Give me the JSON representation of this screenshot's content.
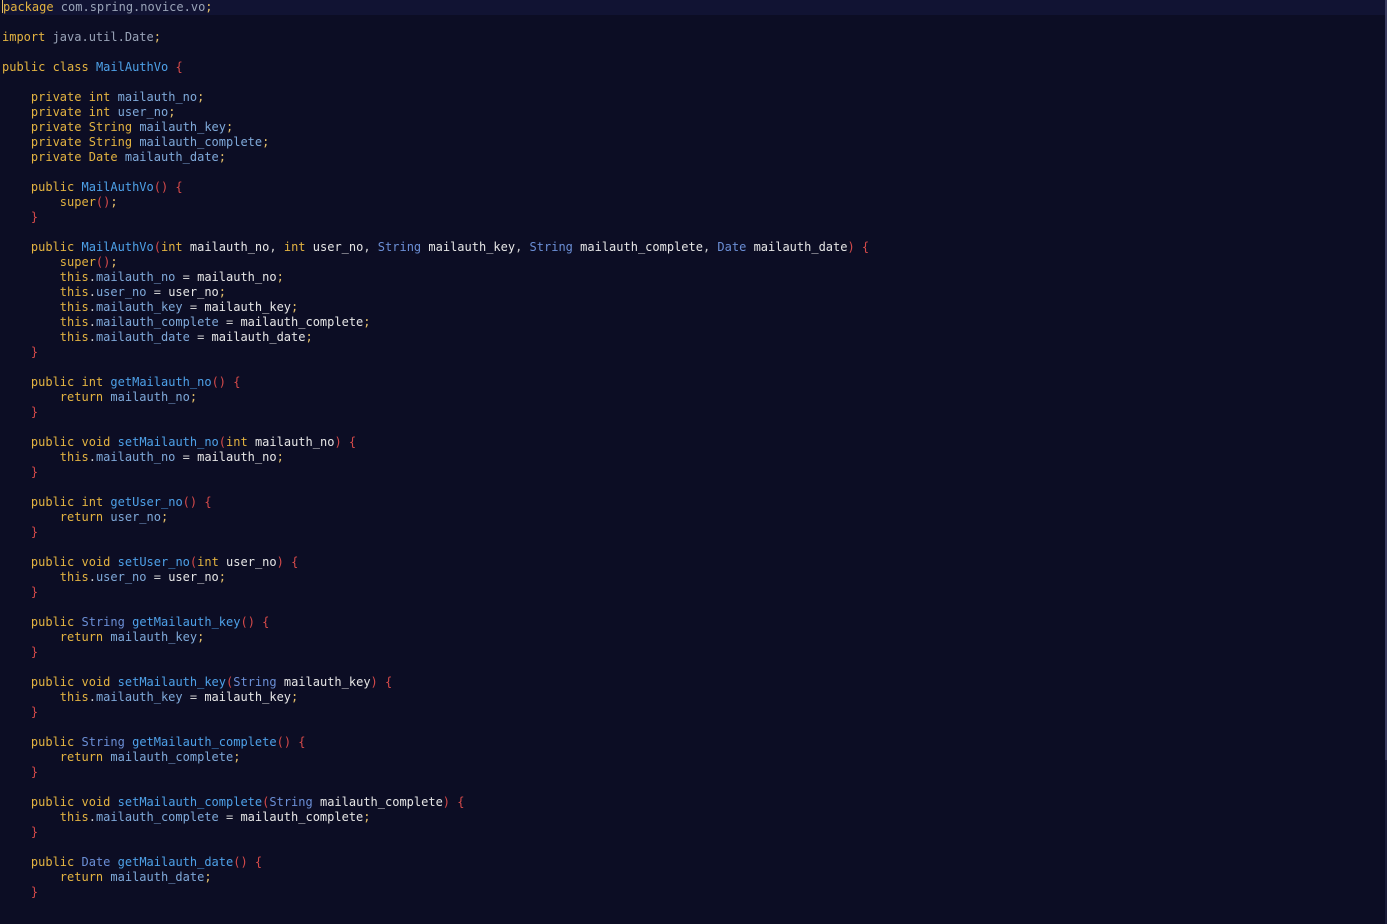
{
  "editor": {
    "language": "java",
    "lines": [
      [
        [
          "kw",
          "package"
        ],
        [
          "pkg",
          " com.spring.novice.vo"
        ],
        [
          "semi",
          ";"
        ]
      ],
      [],
      [
        [
          "kw",
          "import"
        ],
        [
          "pkg",
          " java.util.Date"
        ],
        [
          "semi",
          ";"
        ]
      ],
      [],
      [
        [
          "kw",
          "public"
        ],
        [
          "op",
          " "
        ],
        [
          "kw",
          "class"
        ],
        [
          "op",
          " "
        ],
        [
          "fn",
          "MailAuthVo"
        ],
        [
          "op",
          " "
        ],
        [
          "punc",
          "{"
        ]
      ],
      [],
      [
        [
          "op",
          "    "
        ],
        [
          "kw",
          "private"
        ],
        [
          "op",
          " "
        ],
        [
          "kw",
          "int"
        ],
        [
          "op",
          " "
        ],
        [
          "field",
          "mailauth_no"
        ],
        [
          "semi",
          ";"
        ]
      ],
      [
        [
          "op",
          "    "
        ],
        [
          "kw",
          "private"
        ],
        [
          "op",
          " "
        ],
        [
          "kw",
          "int"
        ],
        [
          "op",
          " "
        ],
        [
          "field",
          "user_no"
        ],
        [
          "semi",
          ";"
        ]
      ],
      [
        [
          "op",
          "    "
        ],
        [
          "kw",
          "private"
        ],
        [
          "op",
          " "
        ],
        [
          "kw",
          "String"
        ],
        [
          "op",
          " "
        ],
        [
          "field",
          "mailauth_key"
        ],
        [
          "semi",
          ";"
        ]
      ],
      [
        [
          "op",
          "    "
        ],
        [
          "kw",
          "private"
        ],
        [
          "op",
          " "
        ],
        [
          "kw",
          "String"
        ],
        [
          "op",
          " "
        ],
        [
          "field",
          "mailauth_complete"
        ],
        [
          "semi",
          ";"
        ]
      ],
      [
        [
          "op",
          "    "
        ],
        [
          "kw",
          "private"
        ],
        [
          "op",
          " "
        ],
        [
          "kw",
          "Date"
        ],
        [
          "op",
          " "
        ],
        [
          "field",
          "mailauth_date"
        ],
        [
          "semi",
          ";"
        ]
      ],
      [],
      [
        [
          "op",
          "    "
        ],
        [
          "kw",
          "public"
        ],
        [
          "op",
          " "
        ],
        [
          "fn",
          "MailAuthVo"
        ],
        [
          "punc",
          "() {"
        ]
      ],
      [
        [
          "op",
          "        "
        ],
        [
          "kw",
          "super"
        ],
        [
          "punc",
          "()"
        ],
        [
          "semi",
          ";"
        ]
      ],
      [
        [
          "op",
          "    "
        ],
        [
          "punc",
          "}"
        ]
      ],
      [],
      [
        [
          "op",
          "    "
        ],
        [
          "kw",
          "public"
        ],
        [
          "op",
          " "
        ],
        [
          "fn",
          "MailAuthVo"
        ],
        [
          "punc",
          "("
        ],
        [
          "kw",
          "int"
        ],
        [
          "op",
          " "
        ],
        [
          "var",
          "mailauth_no"
        ],
        [
          "op",
          ", "
        ],
        [
          "kw",
          "int"
        ],
        [
          "op",
          " "
        ],
        [
          "var",
          "user_no"
        ],
        [
          "op",
          ", "
        ],
        [
          "type",
          "String"
        ],
        [
          "op",
          " "
        ],
        [
          "var",
          "mailauth_key"
        ],
        [
          "op",
          ", "
        ],
        [
          "type",
          "String"
        ],
        [
          "op",
          " "
        ],
        [
          "var",
          "mailauth_complete"
        ],
        [
          "op",
          ", "
        ],
        [
          "type",
          "Date"
        ],
        [
          "op",
          " "
        ],
        [
          "var",
          "mailauth_date"
        ],
        [
          "punc",
          ") {"
        ]
      ],
      [
        [
          "op",
          "        "
        ],
        [
          "kw",
          "super"
        ],
        [
          "punc",
          "()"
        ],
        [
          "semi",
          ";"
        ]
      ],
      [
        [
          "op",
          "        "
        ],
        [
          "kw",
          "this"
        ],
        [
          "op",
          "."
        ],
        [
          "field",
          "mailauth_no"
        ],
        [
          "op",
          " = "
        ],
        [
          "var",
          "mailauth_no"
        ],
        [
          "semi",
          ";"
        ]
      ],
      [
        [
          "op",
          "        "
        ],
        [
          "kw",
          "this"
        ],
        [
          "op",
          "."
        ],
        [
          "field",
          "user_no"
        ],
        [
          "op",
          " = "
        ],
        [
          "var",
          "user_no"
        ],
        [
          "semi",
          ";"
        ]
      ],
      [
        [
          "op",
          "        "
        ],
        [
          "kw",
          "this"
        ],
        [
          "op",
          "."
        ],
        [
          "field",
          "mailauth_key"
        ],
        [
          "op",
          " = "
        ],
        [
          "var",
          "mailauth_key"
        ],
        [
          "semi",
          ";"
        ]
      ],
      [
        [
          "op",
          "        "
        ],
        [
          "kw",
          "this"
        ],
        [
          "op",
          "."
        ],
        [
          "field",
          "mailauth_complete"
        ],
        [
          "op",
          " = "
        ],
        [
          "var",
          "mailauth_complete"
        ],
        [
          "semi",
          ";"
        ]
      ],
      [
        [
          "op",
          "        "
        ],
        [
          "kw",
          "this"
        ],
        [
          "op",
          "."
        ],
        [
          "field",
          "mailauth_date"
        ],
        [
          "op",
          " = "
        ],
        [
          "var",
          "mailauth_date"
        ],
        [
          "semi",
          ";"
        ]
      ],
      [
        [
          "op",
          "    "
        ],
        [
          "punc",
          "}"
        ]
      ],
      [],
      [
        [
          "op",
          "    "
        ],
        [
          "kw",
          "public"
        ],
        [
          "op",
          " "
        ],
        [
          "kw",
          "int"
        ],
        [
          "op",
          " "
        ],
        [
          "fn",
          "getMailauth_no"
        ],
        [
          "punc",
          "() {"
        ]
      ],
      [
        [
          "op",
          "        "
        ],
        [
          "kw",
          "return"
        ],
        [
          "op",
          " "
        ],
        [
          "field",
          "mailauth_no"
        ],
        [
          "semi",
          ";"
        ]
      ],
      [
        [
          "op",
          "    "
        ],
        [
          "punc",
          "}"
        ]
      ],
      [],
      [
        [
          "op",
          "    "
        ],
        [
          "kw",
          "public"
        ],
        [
          "op",
          " "
        ],
        [
          "kw",
          "void"
        ],
        [
          "op",
          " "
        ],
        [
          "fn",
          "setMailauth_no"
        ],
        [
          "punc",
          "("
        ],
        [
          "kw",
          "int"
        ],
        [
          "op",
          " "
        ],
        [
          "var",
          "mailauth_no"
        ],
        [
          "punc",
          ") {"
        ]
      ],
      [
        [
          "op",
          "        "
        ],
        [
          "kw",
          "this"
        ],
        [
          "op",
          "."
        ],
        [
          "field",
          "mailauth_no"
        ],
        [
          "op",
          " = "
        ],
        [
          "var",
          "mailauth_no"
        ],
        [
          "semi",
          ";"
        ]
      ],
      [
        [
          "op",
          "    "
        ],
        [
          "punc",
          "}"
        ]
      ],
      [],
      [
        [
          "op",
          "    "
        ],
        [
          "kw",
          "public"
        ],
        [
          "op",
          " "
        ],
        [
          "kw",
          "int"
        ],
        [
          "op",
          " "
        ],
        [
          "fn",
          "getUser_no"
        ],
        [
          "punc",
          "() {"
        ]
      ],
      [
        [
          "op",
          "        "
        ],
        [
          "kw",
          "return"
        ],
        [
          "op",
          " "
        ],
        [
          "field",
          "user_no"
        ],
        [
          "semi",
          ";"
        ]
      ],
      [
        [
          "op",
          "    "
        ],
        [
          "punc",
          "}"
        ]
      ],
      [],
      [
        [
          "op",
          "    "
        ],
        [
          "kw",
          "public"
        ],
        [
          "op",
          " "
        ],
        [
          "kw",
          "void"
        ],
        [
          "op",
          " "
        ],
        [
          "fn",
          "setUser_no"
        ],
        [
          "punc",
          "("
        ],
        [
          "kw",
          "int"
        ],
        [
          "op",
          " "
        ],
        [
          "var",
          "user_no"
        ],
        [
          "punc",
          ") {"
        ]
      ],
      [
        [
          "op",
          "        "
        ],
        [
          "kw",
          "this"
        ],
        [
          "op",
          "."
        ],
        [
          "field",
          "user_no"
        ],
        [
          "op",
          " = "
        ],
        [
          "var",
          "user_no"
        ],
        [
          "semi",
          ";"
        ]
      ],
      [
        [
          "op",
          "    "
        ],
        [
          "punc",
          "}"
        ]
      ],
      [],
      [
        [
          "op",
          "    "
        ],
        [
          "kw",
          "public"
        ],
        [
          "op",
          " "
        ],
        [
          "type",
          "String"
        ],
        [
          "op",
          " "
        ],
        [
          "fn",
          "getMailauth_key"
        ],
        [
          "punc",
          "() {"
        ]
      ],
      [
        [
          "op",
          "        "
        ],
        [
          "kw",
          "return"
        ],
        [
          "op",
          " "
        ],
        [
          "field",
          "mailauth_key"
        ],
        [
          "semi",
          ";"
        ]
      ],
      [
        [
          "op",
          "    "
        ],
        [
          "punc",
          "}"
        ]
      ],
      [],
      [
        [
          "op",
          "    "
        ],
        [
          "kw",
          "public"
        ],
        [
          "op",
          " "
        ],
        [
          "kw",
          "void"
        ],
        [
          "op",
          " "
        ],
        [
          "fn",
          "setMailauth_key"
        ],
        [
          "punc",
          "("
        ],
        [
          "type",
          "String"
        ],
        [
          "op",
          " "
        ],
        [
          "var",
          "mailauth_key"
        ],
        [
          "punc",
          ") {"
        ]
      ],
      [
        [
          "op",
          "        "
        ],
        [
          "kw",
          "this"
        ],
        [
          "op",
          "."
        ],
        [
          "field",
          "mailauth_key"
        ],
        [
          "op",
          " = "
        ],
        [
          "var",
          "mailauth_key"
        ],
        [
          "semi",
          ";"
        ]
      ],
      [
        [
          "op",
          "    "
        ],
        [
          "punc",
          "}"
        ]
      ],
      [],
      [
        [
          "op",
          "    "
        ],
        [
          "kw",
          "public"
        ],
        [
          "op",
          " "
        ],
        [
          "type",
          "String"
        ],
        [
          "op",
          " "
        ],
        [
          "fn",
          "getMailauth_complete"
        ],
        [
          "punc",
          "() {"
        ]
      ],
      [
        [
          "op",
          "        "
        ],
        [
          "kw",
          "return"
        ],
        [
          "op",
          " "
        ],
        [
          "field",
          "mailauth_complete"
        ],
        [
          "semi",
          ";"
        ]
      ],
      [
        [
          "op",
          "    "
        ],
        [
          "punc",
          "}"
        ]
      ],
      [],
      [
        [
          "op",
          "    "
        ],
        [
          "kw",
          "public"
        ],
        [
          "op",
          " "
        ],
        [
          "kw",
          "void"
        ],
        [
          "op",
          " "
        ],
        [
          "fn",
          "setMailauth_complete"
        ],
        [
          "punc",
          "("
        ],
        [
          "type",
          "String"
        ],
        [
          "op",
          " "
        ],
        [
          "var",
          "mailauth_complete"
        ],
        [
          "punc",
          ") {"
        ]
      ],
      [
        [
          "op",
          "        "
        ],
        [
          "kw",
          "this"
        ],
        [
          "op",
          "."
        ],
        [
          "field",
          "mailauth_complete"
        ],
        [
          "op",
          " = "
        ],
        [
          "var",
          "mailauth_complete"
        ],
        [
          "semi",
          ";"
        ]
      ],
      [
        [
          "op",
          "    "
        ],
        [
          "punc",
          "}"
        ]
      ],
      [],
      [
        [
          "op",
          "    "
        ],
        [
          "kw",
          "public"
        ],
        [
          "op",
          " "
        ],
        [
          "type",
          "Date"
        ],
        [
          "op",
          " "
        ],
        [
          "fn",
          "getMailauth_date"
        ],
        [
          "punc",
          "() {"
        ]
      ],
      [
        [
          "op",
          "        "
        ],
        [
          "kw",
          "return"
        ],
        [
          "op",
          " "
        ],
        [
          "field",
          "mailauth_date"
        ],
        [
          "semi",
          ";"
        ]
      ],
      [
        [
          "op",
          "    "
        ],
        [
          "punc",
          "}"
        ]
      ]
    ],
    "colors": {
      "background": "#0c0d24",
      "keyword": "#e3b341",
      "type": "#6b8fd6",
      "function": "#4ea1e8",
      "field": "#7fa9d9",
      "variable": "#e6e6e6",
      "brace": "#d64a4a"
    }
  }
}
